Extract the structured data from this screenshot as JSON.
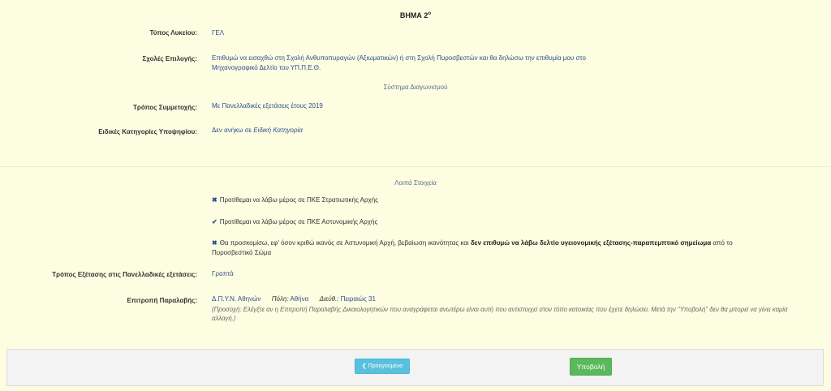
{
  "step": {
    "label": "ΒΗΜΑ 2",
    "sup": "ο"
  },
  "school_type": {
    "label": "Τύπος Λυκείου:",
    "value": "ΓΕΛ"
  },
  "schools": {
    "label": "Σχολές Επιλογής:",
    "line1": "Επιθυμώ να εισαχθώ στη Σχολή Ανθυποπυραγών (Αξιωματικών) ή στη Σχολή Πυροσβεστών και θα δηλώσω την επιθυμία μου στο",
    "line2": "Μηχανογραφικό Δελτίο του ΥΠ.Π.Ε.Θ."
  },
  "exam_system": "Σύστημα Διαγωνισμού",
  "participation": {
    "label": "Τρόπος Συμμετοχής:",
    "value": "Με Πανελλαδικές εξετάσεις έτους 2019"
  },
  "special_categories": {
    "label": "Ειδικές Κατηγορίες Υποψηφίου:",
    "prefix": "Δεν ανήκω σε ",
    "value": "Ειδική Κατηγορία"
  },
  "other_details": "Λοιπά Στοιχεία",
  "checks": {
    "army": {
      "mark": "✖",
      "text": "Προτίθεμαι να λάβω μέρος σε ΠΚΕ Στρατιωτικής Αρχής"
    },
    "police": {
      "mark": "✔",
      "text": "Προτίθεμαι να λάβω μέρος σε ΠΚΕ Αστυνομικής Αρχής"
    },
    "health": {
      "mark": "✖",
      "text1": "Θα προσκομίσω, εφ' όσον κριθώ ικανός σε Αστυνομική Αρχή, βεβαίωση ικανότητας και ",
      "bold": "δεν επιθυμώ να λάβω δελτίο υγειονομικής εξέτασης-παραπεμπτικό σημείωμα",
      "text2": " από το",
      "line2": "Πυροσβεστικό Σώμα"
    }
  },
  "exam_method": {
    "label": "Τρόπος Εξέτασης στις Πανελλαδικές εξετάσεις:",
    "value": "Γραπτά"
  },
  "committee": {
    "label": "Επιτροπή Παραλαβής:",
    "name": "Δ.Π.Υ.Ν. Αθηνών",
    "city_label": "Πόλη:",
    "city": "Αθήνα",
    "address_label": "Διεύθ.:",
    "address": "Πειραιώς 31",
    "note1": "(Προσοχή: Ελέγξτε αν η Επιτροπή Παραλαβής Δικαιολογητικών που αναγράφεται ανωτέρω είναι αυτή που αντιστοιχεί στον τόπο κατοικίας που έχετε δηλώσει. Μετά την \"Υποβολή\" δεν θα μπορεί να γίνει καμία",
    "note2": "αλλαγή.)"
  },
  "buttons": {
    "prev_icon": "❮",
    "prev": "Προηγούμενο",
    "submit": "Υποβολή"
  }
}
